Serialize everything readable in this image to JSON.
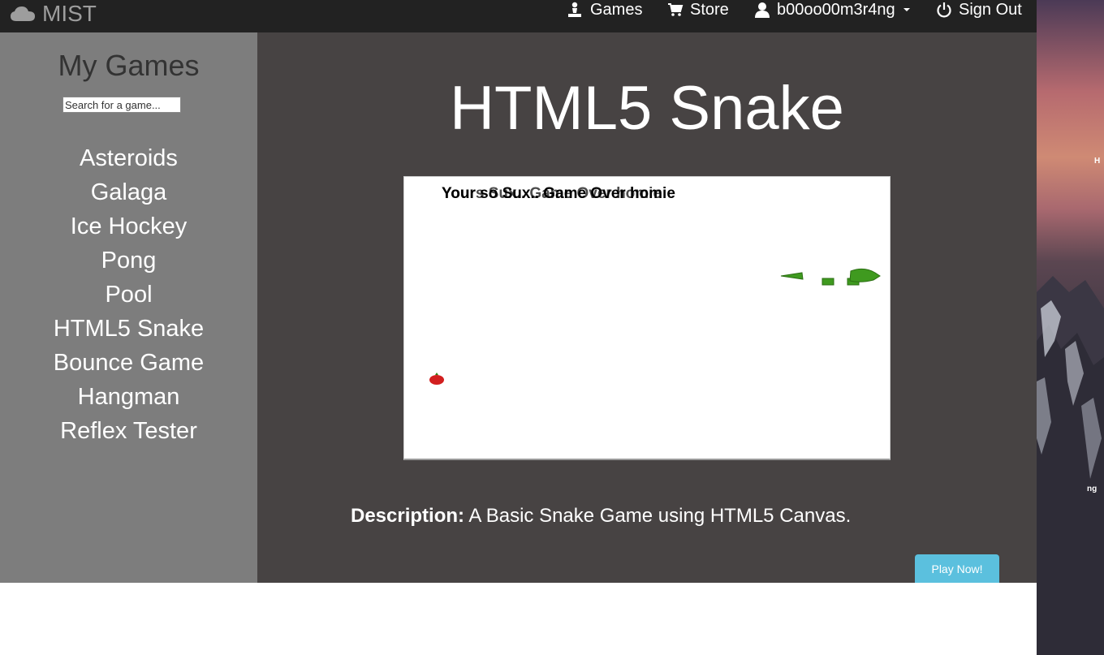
{
  "navbar": {
    "brand": "MIST",
    "games_label": "Games",
    "store_label": "Store",
    "user_label": "b00oo00m3r4ng",
    "signout_label": "Sign Out"
  },
  "sidebar": {
    "title": "My Games",
    "search_placeholder": "Search for a game...",
    "games": [
      "Asteroids",
      "Galaga",
      "Ice Hockey",
      "Pong",
      "Pool",
      "HTML5 Snake",
      "Bounce Game",
      "Hangman",
      "Reflex Tester"
    ]
  },
  "main": {
    "title": "HTML5 Snake",
    "canvas_text_1": "Your so Sux.. Game Over homie",
    "canvas_text_2": "Yours  Sux.. Game Over homie",
    "description_label": "Description:",
    "description_text": " A Basic Snake Game using HTML5 Canvas.",
    "play_label": "Play Now!"
  },
  "desktop": {
    "label_1": "H",
    "label_2": "ng"
  },
  "colors": {
    "navbar": "#222222",
    "sidebar": "#7d7d7d",
    "main": "#474343",
    "play_button": "#5bc0de",
    "snake": "#3f9a1f",
    "apple": "#d21f1f"
  },
  "icons": [
    "cloud-icon",
    "pawn-icon",
    "cart-icon",
    "user-icon",
    "power-icon",
    "apple-icon"
  ]
}
